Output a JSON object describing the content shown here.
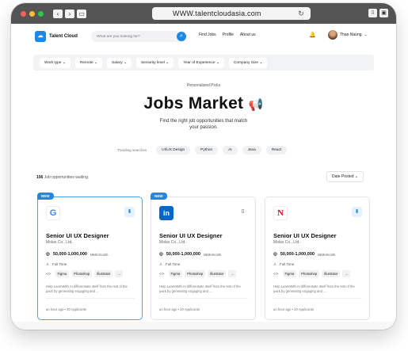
{
  "browser": {
    "url": "WWW.talentcloudasia.com",
    "back": "‹",
    "forward": "›",
    "reload": "↻"
  },
  "header": {
    "brand": "Talent Cloud",
    "search_placeholder": "What are you looking for?",
    "menu": [
      "Find Jobs",
      "Profile",
      "About us"
    ],
    "user_name": "Than Naung"
  },
  "filters": [
    "Work type ⌄",
    "Remote ⌄",
    "Salary ⌄",
    "Seniority level ⌄",
    "Year of Experience ⌄",
    "Company Size ⌄"
  ],
  "hero": {
    "kicker": "Personalized Picks",
    "title": "Jobs Market",
    "subtitle": "Find the right job opportunities that match your passion."
  },
  "trending": {
    "label": "Trending searches",
    "tags": [
      "UI/UX Design",
      "Python",
      "AI",
      "Java",
      "React"
    ]
  },
  "results": {
    "count": "106",
    "count_suffix": "Job opportunities waiting.",
    "sort_label": "Date Posted ⌄"
  },
  "cards": [
    {
      "badge": "NEW",
      "logo": "G",
      "title": "Senior UI UX Designer",
      "company": "Molax Co., Ltd.",
      "salary": "50,000-1,000,000",
      "salary_unit": "MMK/month",
      "job_type": "Full Time",
      "skills": [
        "Figma",
        "Photoshop",
        "Illustrator",
        "..."
      ],
      "description": "Help LearnWith AI differentiate itself from the rest of the pack by generating engaging and ...",
      "posted": "an hour ago",
      "applicants": "20 Applicants"
    },
    {
      "badge": "NEW",
      "logo": "in",
      "title": "Senior UI UX Designer",
      "company": "Molax Co., Ltd.",
      "salary": "50,000-1,000,000",
      "salary_unit": "MMK/month",
      "job_type": "Full Time",
      "skills": [
        "Figma",
        "Photoshop",
        "Illustrator",
        "..."
      ],
      "description": "Help LearnWith AI differentiate itself from the rest of the pack by generating engaging and ...",
      "posted": "an hour ago",
      "applicants": "20 Applicants"
    },
    {
      "badge": "",
      "logo": "N",
      "title": "Senior UI UX Designer",
      "company": "Molax Co., Ltd.",
      "salary": "50,000-1,000,000",
      "salary_unit": "MMK/month",
      "job_type": "Full Time",
      "skills": [
        "Figma",
        "Photoshop",
        "Illustrator",
        "..."
      ],
      "description": "Help LearnWith AI differentiate itself from the rest of the pack by generating engaging and ...",
      "posted": "an hour ago",
      "applicants": "20 Applicants"
    }
  ],
  "colors": {
    "accent": "#1e88e5",
    "google": "#4285f4",
    "linkedin": "#0a66c2",
    "netflix": "#e50914"
  }
}
